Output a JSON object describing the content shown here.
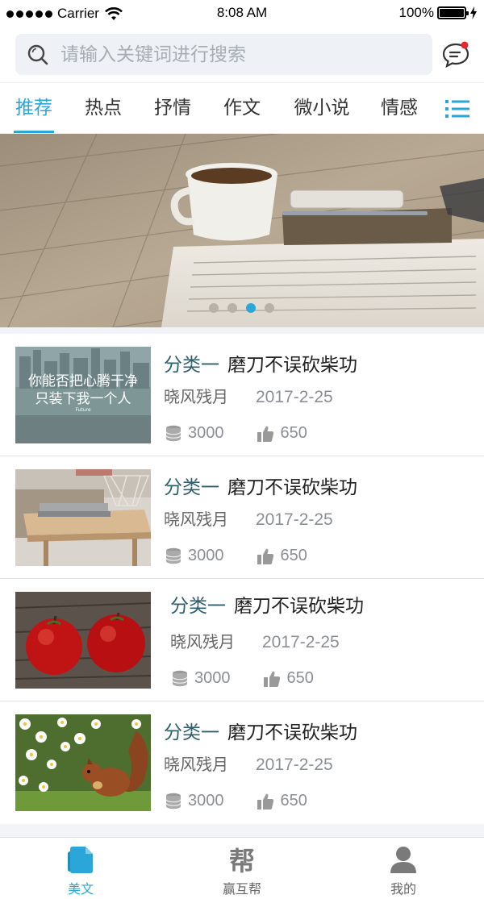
{
  "status_bar": {
    "carrier": "Carrier",
    "time": "8:08 AM",
    "battery": "100%",
    "battery_level": 1.0
  },
  "search": {
    "placeholder": "请输入关键词进行搜索",
    "value": ""
  },
  "icons": {
    "search": "search-icon",
    "message": "message-icon",
    "menu": "menu-icon",
    "coin": "coin-stack-icon",
    "like": "thumbs-up-icon"
  },
  "tabs": [
    {
      "label": "推荐",
      "active": true
    },
    {
      "label": "热点",
      "active": false
    },
    {
      "label": "抒情",
      "active": false
    },
    {
      "label": "作文",
      "active": false
    },
    {
      "label": "微小说",
      "active": false
    },
    {
      "label": "情感",
      "active": false
    }
  ],
  "banner": {
    "slide_count": 4,
    "active_slide": 3
  },
  "articles": [
    {
      "category": "分类一",
      "title": "磨刀不误砍柴功",
      "author": "晓风残月",
      "date": "2017-2-25",
      "coins": "3000",
      "likes": "650",
      "thumb_text_1": "你能否把心腾干净",
      "thumb_text_2": "只装下我一个人",
      "thumb_text_3": "Future"
    },
    {
      "category": "分类一",
      "title": "磨刀不误砍柴功",
      "author": "晓风残月",
      "date": "2017-2-25",
      "coins": "3000",
      "likes": "650"
    },
    {
      "category": "分类一",
      "title": "磨刀不误砍柴功",
      "author": "晓风残月",
      "date": "2017-2-25",
      "coins": "3000",
      "likes": "650"
    },
    {
      "category": "分类一",
      "title": "磨刀不误砍柴功",
      "author": "晓风残月",
      "date": "2017-2-25",
      "coins": "3000",
      "likes": "650"
    }
  ],
  "bottom_nav": [
    {
      "label": "美文",
      "active": true
    },
    {
      "label": "赢互帮",
      "active": false,
      "glyph": "帮"
    },
    {
      "label": "我的",
      "active": false
    }
  ],
  "colors": {
    "accent": "#2aa7d8",
    "category": "#2f5f6f",
    "notification": "#e8262d"
  }
}
